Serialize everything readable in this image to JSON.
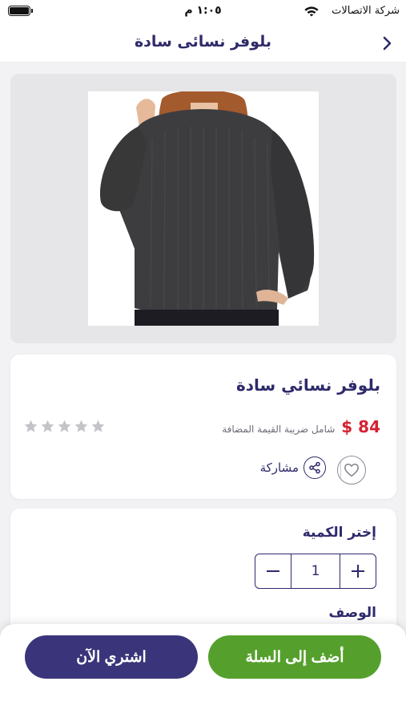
{
  "status_bar": {
    "carrier": "شركة الاتصالات",
    "time": "١:٠٥ م"
  },
  "nav": {
    "title": "بلوفر نسائى سادة",
    "back_icon": "chevron-right-icon"
  },
  "product": {
    "title": "بلوفر نسائي سادة",
    "price": "$ 84",
    "vat_note": "شامل ضريبة القيمة المضافة",
    "rating": {
      "value": 0,
      "max": 5
    },
    "share_label": "مشاركة"
  },
  "quantity": {
    "label": "إختر الكمية",
    "value": "1"
  },
  "description": {
    "label": "الوصف"
  },
  "actions": {
    "add_to_cart": "أضف إلى السلة",
    "buy_now": "اشتري الآن"
  },
  "colors": {
    "primary": "#2e2a6b",
    "price": "#d42232",
    "cart_button": "#55a02c",
    "buy_button": "#3a357a",
    "star_empty": "#c4c4c8"
  }
}
